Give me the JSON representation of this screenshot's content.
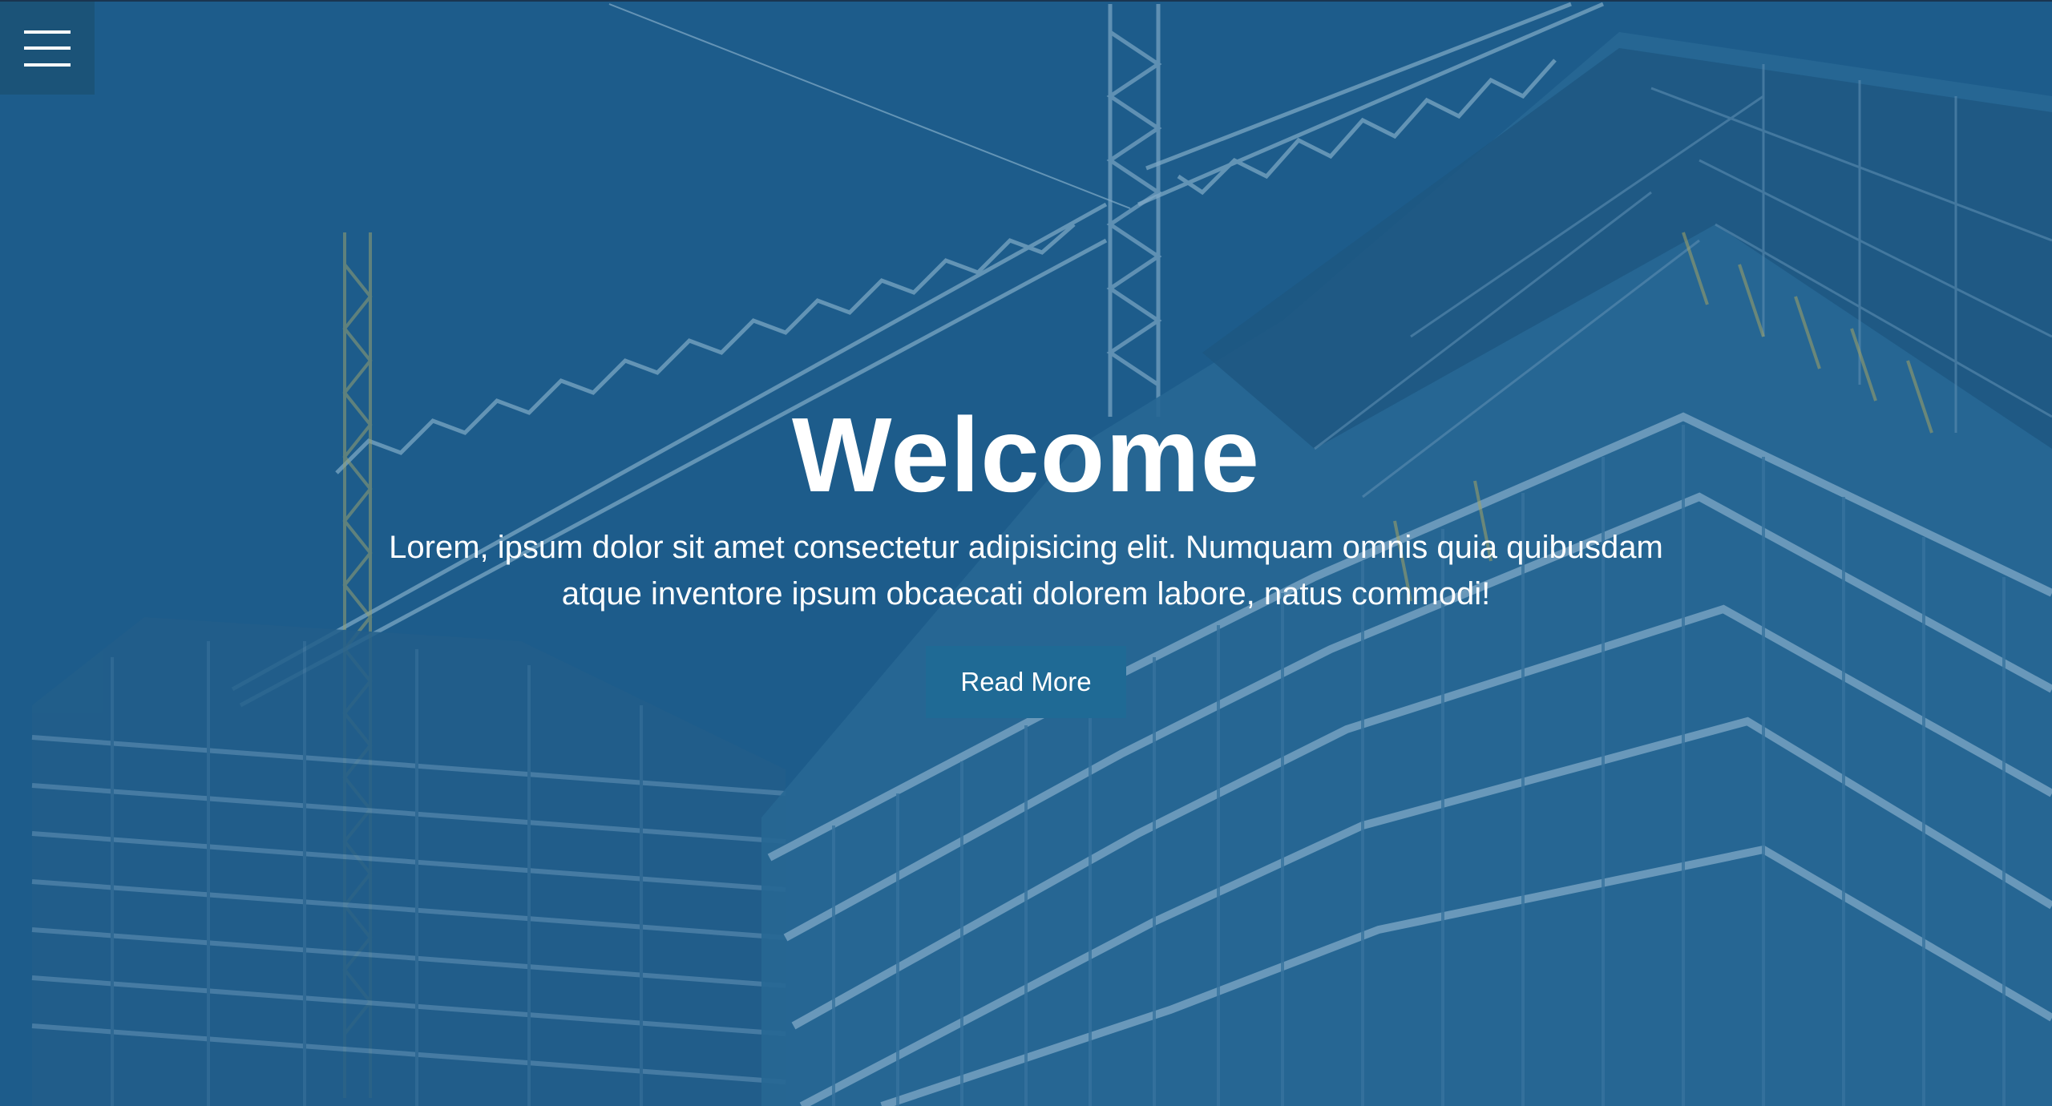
{
  "nav": {
    "menu_icon": "hamburger-menu-icon"
  },
  "hero": {
    "background": "construction-site-photo",
    "title": "Welcome",
    "paragraph": "Lorem, ipsum dolor sit amet consectetur adipisicing elit. Numquam omnis quia quibusdam atque inventore ipsum obcaecati dolorem labore, natus commodi!",
    "cta_label": "Read More"
  },
  "colors": {
    "overlay": "#1f5a86",
    "menu_button": "#1b5378",
    "cta_button": "#1f6a95",
    "text": "#ffffff"
  }
}
